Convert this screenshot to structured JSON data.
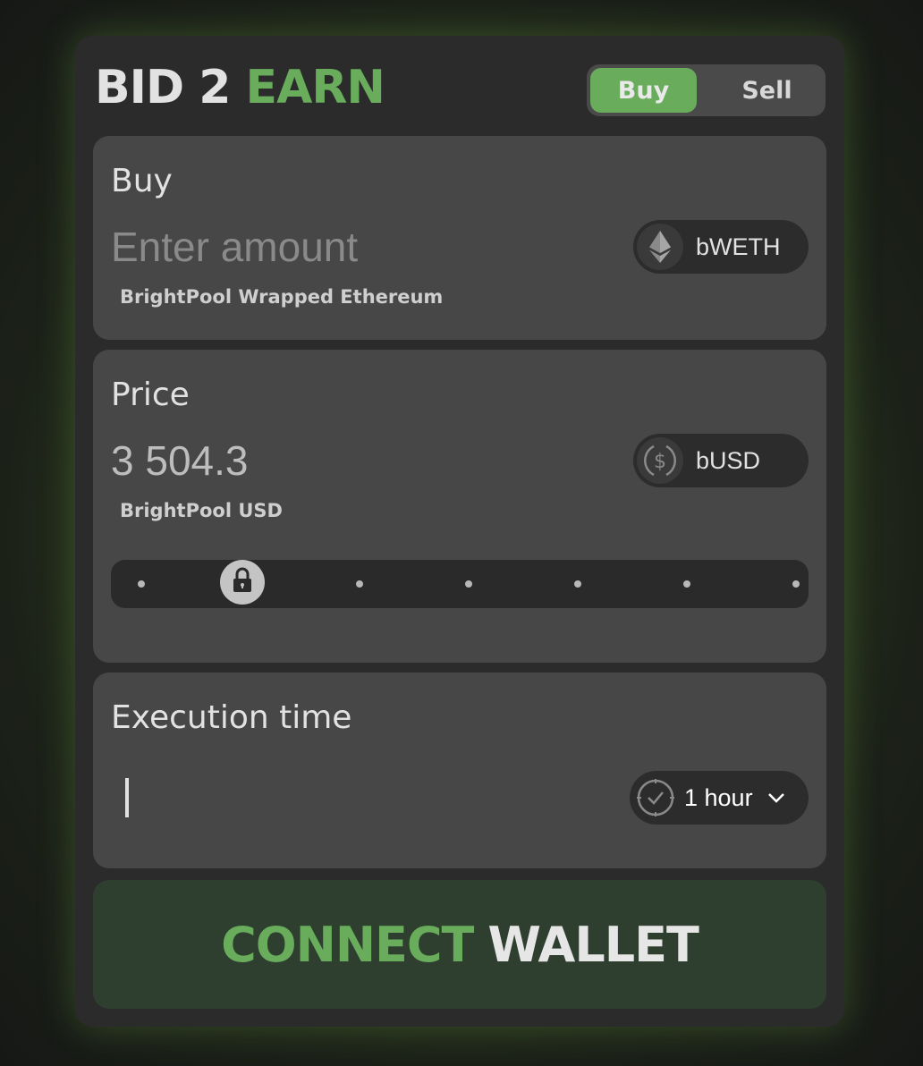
{
  "brand": {
    "part1": "BID 2",
    "part2": "EARN"
  },
  "mode_toggle": {
    "options": [
      "Buy",
      "Sell"
    ],
    "selected": "Buy"
  },
  "buy_panel": {
    "label": "Buy",
    "amount_placeholder": "Enter amount",
    "amount_value": "",
    "token_symbol": "bWETH",
    "token_name": "BrightPool Wrapped Ethereum",
    "token_icon": "ethereum-icon"
  },
  "price_panel": {
    "label": "Price",
    "value": "3 504.3",
    "token_symbol": "bUSD",
    "token_name": "BrightPool USD",
    "token_icon": "dollar-coin-icon",
    "slider": {
      "steps": 7,
      "selected_index": 1,
      "thumb_icon": "lock-icon"
    }
  },
  "execution_panel": {
    "label": "Execution time",
    "selected_time": "1 hour",
    "time_icon": "clock-icon",
    "dropdown_icon": "chevron-down-icon"
  },
  "connect_button": {
    "part1": "CONNECT",
    "part2": "WALLET"
  },
  "colors": {
    "accent": "#68ac5c",
    "card": "#2b2b2b",
    "panel": "#474747",
    "button_bg": "#2e3f2f"
  }
}
